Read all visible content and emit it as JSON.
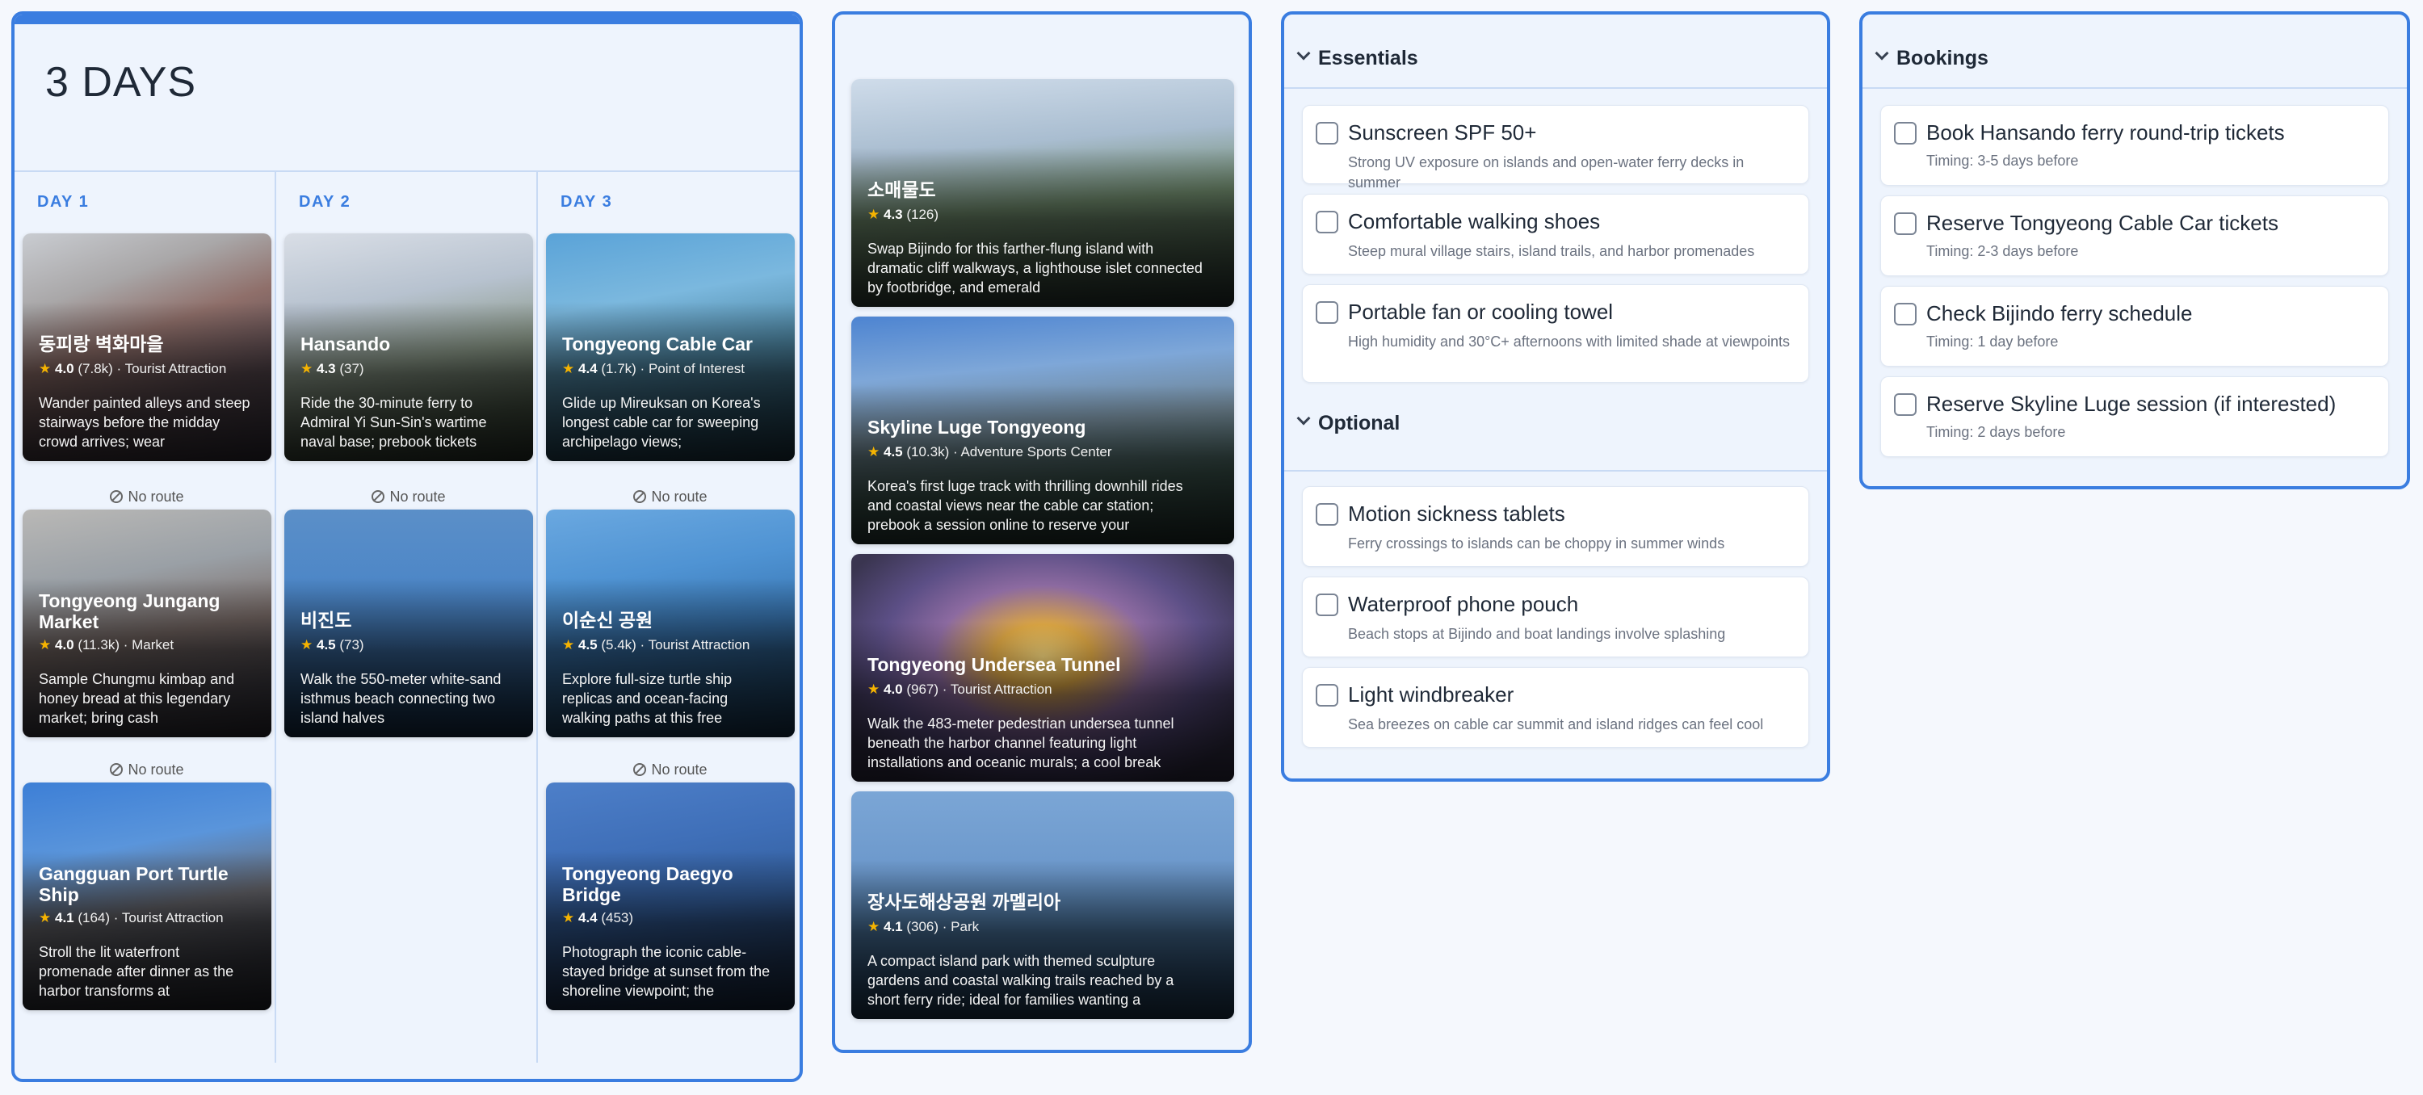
{
  "itinerary": {
    "title": "3 DAYS",
    "days": [
      {
        "label": "DAY 1",
        "cards": [
          {
            "name": "동피랑 벽화마을",
            "rating": "4.0",
            "count": "(7.8k)",
            "category": "Tourist Attraction",
            "desc": "Wander painted alleys and steep stairways before the midday crowd arrives; wear",
            "image": "mural-village-alley"
          },
          {
            "name": "Tongyeong Jungang Market",
            "rating": "4.0",
            "count": "(11.3k)",
            "category": "Market",
            "desc": "Sample Chungmu kimbap and honey bread at this legendary market; bring cash",
            "image": "market-alley"
          },
          {
            "name": "Gangguan Port Turtle Ship",
            "rating": "4.1",
            "count": "(164)",
            "category": "Tourist Attraction",
            "desc": "Stroll the lit waterfront promenade after dinner as the harbor transforms at",
            "image": "turtle-ship-harbor"
          }
        ],
        "routes": [
          "No route",
          "No route"
        ]
      },
      {
        "label": "DAY 2",
        "cards": [
          {
            "name": "Hansando",
            "rating": "4.3",
            "count": "(37)",
            "category": "",
            "desc": "Ride the 30-minute ferry to Admiral Yi Sun-Sin's wartime naval base; prebook tickets",
            "image": "island-pine-tree"
          },
          {
            "name": "비진도",
            "rating": "4.5",
            "count": "(73)",
            "category": "",
            "desc": "Walk the 550-meter white-sand isthmus beach connecting two island halves",
            "image": "blue-sea"
          }
        ],
        "routes": [
          "No route"
        ]
      },
      {
        "label": "DAY 3",
        "cards": [
          {
            "name": "Tongyeong Cable Car",
            "rating": "4.4",
            "count": "(1.7k)",
            "category": "Point of Interest",
            "desc": "Glide up Mireuksan on Korea's longest cable car for sweeping archipelago views;",
            "image": "cable-car-view"
          },
          {
            "name": "이순신 공원",
            "rating": "4.5",
            "count": "(5.4k)",
            "category": "Tourist Attraction",
            "desc": "Explore full-size turtle ship replicas and ocean-facing walking paths at this free",
            "image": "park-coast"
          },
          {
            "name": "Tongyeong Daegyo Bridge",
            "rating": "4.4",
            "count": "(453)",
            "category": "",
            "desc": "Photograph the iconic cable-stayed bridge at sunset from the shoreline viewpoint; the",
            "image": "bridge"
          }
        ],
        "routes": [
          "No route",
          "No route"
        ]
      }
    ]
  },
  "suggestions": [
    {
      "name": "소매물도",
      "rating": "4.3",
      "count": "(126)",
      "category": "",
      "desc": "Swap Bijindo for this farther-flung island with dramatic cliff walkways, a lighthouse islet connected by footbridge, and emerald",
      "image": "island-cliffs"
    },
    {
      "name": "Skyline Luge Tongyeong",
      "rating": "4.5",
      "count": "(10.3k)",
      "category": "Adventure Sports Center",
      "desc": "Korea's first luge track with thrilling downhill rides and coastal views near the cable car station; prebook a session online to reserve your",
      "image": "luge-track"
    },
    {
      "name": "Tongyeong Undersea Tunnel",
      "rating": "4.0",
      "count": "(967)",
      "category": "Tourist Attraction",
      "desc": "Walk the 483-meter pedestrian undersea tunnel beneath the harbor channel featuring light installations and oceanic murals; a cool break",
      "image": "tunnel"
    },
    {
      "name": "장사도해상공원 까멜리아",
      "rating": "4.1",
      "count": "(306)",
      "category": "Park",
      "desc": "A compact island park with themed sculpture gardens and coastal walking trails reached by a short ferry ride; ideal for families wanting a",
      "image": "sea-islands"
    }
  ],
  "packing": {
    "sections": [
      {
        "title": "Essentials",
        "items": [
          {
            "title": "Sunscreen SPF 50+",
            "desc": "Strong UV exposure on islands and open-water ferry decks in summer"
          },
          {
            "title": "Comfortable walking shoes",
            "desc": "Steep mural village stairs, island trails, and harbor promenades"
          },
          {
            "title": "Portable fan or cooling towel",
            "desc": "High humidity and 30°C+ afternoons with limited shade at viewpoints"
          }
        ]
      },
      {
        "title": "Optional",
        "items": [
          {
            "title": "Motion sickness tablets",
            "desc": "Ferry crossings to islands can be choppy in summer winds"
          },
          {
            "title": "Waterproof phone pouch",
            "desc": "Beach stops at Bijindo and boat landings involve splashing"
          },
          {
            "title": "Light windbreaker",
            "desc": "Sea breezes on cable car summit and island ridges can feel cool"
          }
        ]
      }
    ]
  },
  "bookings": {
    "title": "Bookings",
    "items": [
      {
        "title": "Book Hansando ferry round-trip tickets",
        "timing": "Timing: 3-5 days before"
      },
      {
        "title": "Reserve Tongyeong Cable Car tickets",
        "timing": "Timing: 2-3 days before"
      },
      {
        "title": "Check Bijindo ferry schedule",
        "timing": "Timing: 1 day before"
      },
      {
        "title": "Reserve Skyline Luge session (if interested)",
        "timing": "Timing: 2 days before"
      }
    ]
  },
  "colors": {
    "accent": "#3a7de0",
    "star": "#f5b301",
    "panel_bg": "#eef4fd"
  }
}
